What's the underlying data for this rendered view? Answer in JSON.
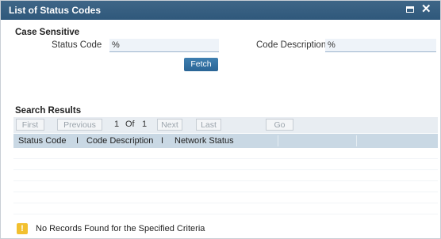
{
  "window": {
    "title": "List of Status Codes"
  },
  "case_section": {
    "title": "Case Sensitive",
    "status_code_label": "Status Code",
    "status_code_value": "%",
    "code_description_label": "Code Description",
    "code_description_value": "%",
    "fetch_label": "Fetch"
  },
  "results": {
    "title": "Search Results",
    "nav": {
      "first": "First",
      "previous": "Previous",
      "current_page": "1",
      "of_label": "Of",
      "total_pages": "1",
      "next": "Next",
      "last": "Last",
      "go": "Go"
    },
    "columns": [
      "Status Code",
      "Code Description",
      "Network Status"
    ],
    "rows": []
  },
  "status_bar": {
    "icon": "warning-icon",
    "message": "No Records Found for the Specified Criteria"
  },
  "colors": {
    "titlebar": "#2f587b",
    "header_row": "#c9d8e4",
    "button": "#2a6596",
    "warning": "#f2c02f"
  }
}
